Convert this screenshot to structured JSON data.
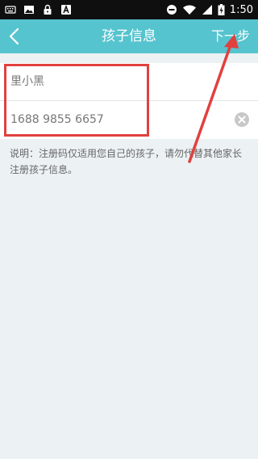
{
  "status_bar": {
    "time": "1:50",
    "left_icons": [
      "keyboard-icon",
      "image-icon",
      "lock-icon",
      "a-box-icon"
    ],
    "right_icons": [
      "do-not-disturb-icon",
      "wifi-icon",
      "signal-icon",
      "battery-charging-icon"
    ]
  },
  "header": {
    "title": "孩子信息",
    "next_label": "下一步",
    "background": "#55c4cf"
  },
  "form": {
    "child_name": "里小黑",
    "registration_code": "1688 9855 6657"
  },
  "note": "说明：注册码仅适用您自己的孩子，请勿代替其他家长注册孩子信息。",
  "annotation": {
    "color": "#e0413f"
  }
}
